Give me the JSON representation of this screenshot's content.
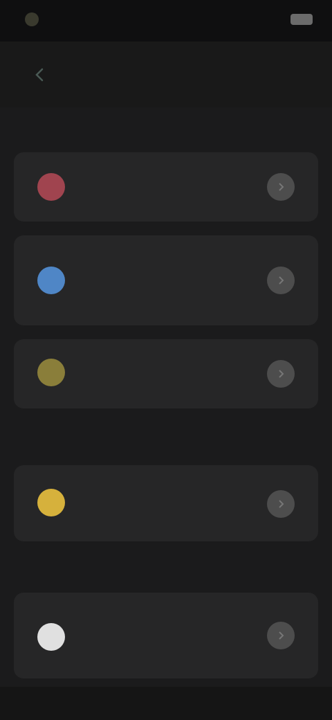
{
  "status_bar": {
    "time": "",
    "signal_text": ""
  },
  "header": {
    "title": ""
  },
  "sections": [
    {
      "title": ""
    },
    {
      "title": ""
    },
    {
      "title": ""
    }
  ],
  "cards": [
    {
      "title": "",
      "subtitle": "",
      "icon": "red-dot-icon",
      "color": "#a0444f"
    },
    {
      "title": "",
      "subtitle": "",
      "icon": "blue-dot-icon",
      "color": "#4f86c6"
    },
    {
      "title": "",
      "subtitle": "",
      "icon": "olive-dot-icon",
      "color": "#8a7e3a"
    },
    {
      "title": "",
      "subtitle": "",
      "icon": "yellow-dot-icon",
      "color": "#d6b13c"
    },
    {
      "title": "",
      "subtitle": "",
      "icon": "white-dot-icon",
      "color": "#e0e0e0"
    }
  ]
}
